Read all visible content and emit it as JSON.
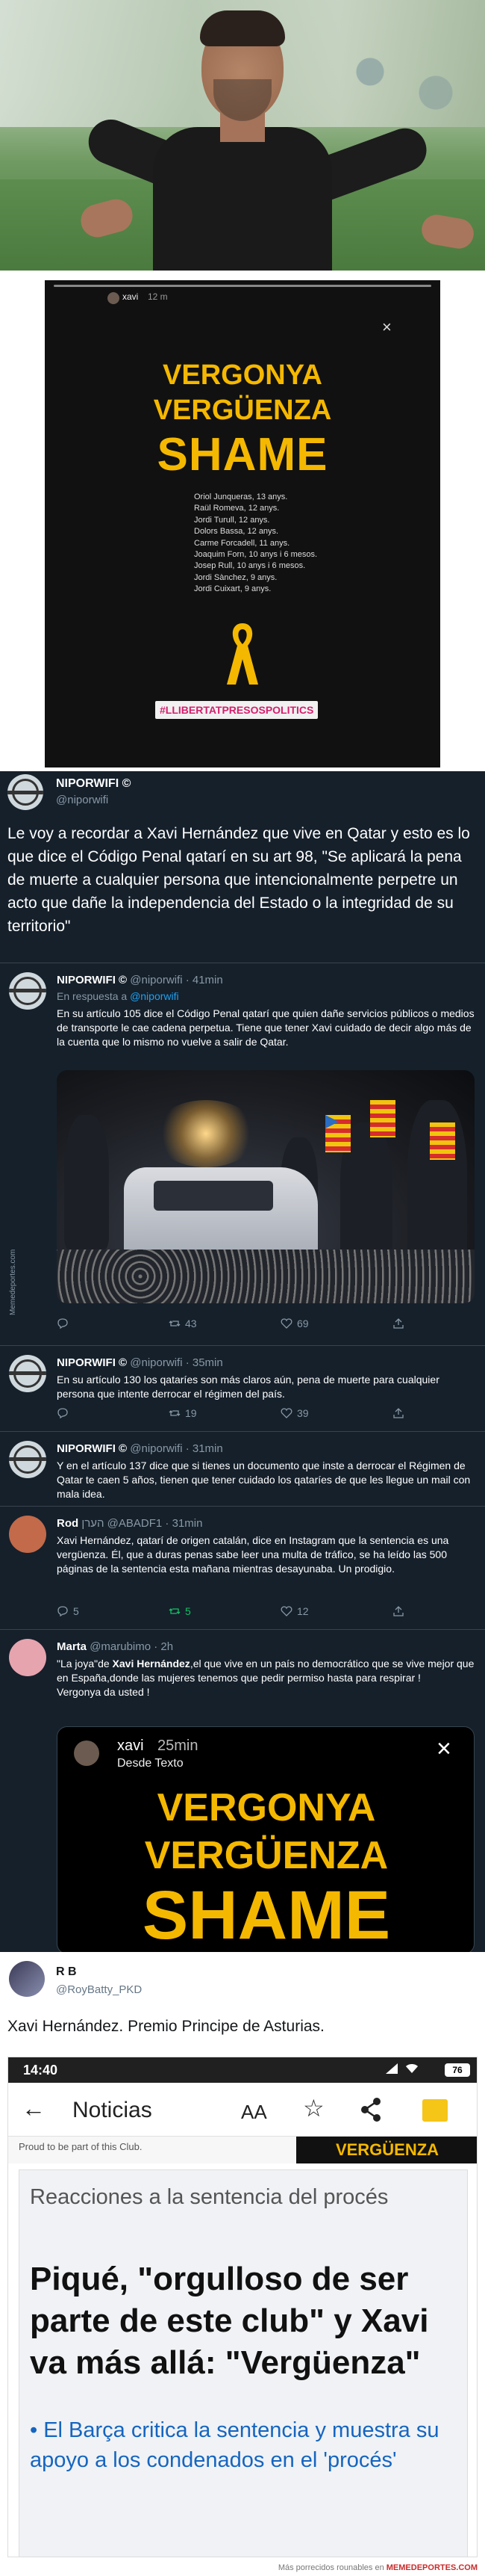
{
  "story": {
    "user": "xavi",
    "time": "12 m",
    "close": "×",
    "word1": "VERGONYA",
    "word2": "VERGÜENZA",
    "word3": "SHAME",
    "names": [
      "Oriol Junqueras, 13 anys.",
      "Raül Romeva, 12 anys.",
      "Jordi Turull, 12 anys.",
      "Dolors Bassa, 12 anys.",
      "Carme Forcadell, 11 anys.",
      "Joaquim Forn, 10 anys i 6 mesos.",
      "Josep Rull, 10 anys i 6 mesos.",
      "Jordi Sànchez, 9 anys.",
      "Jordi Cuixart, 9 anys."
    ],
    "hashtag": "#LLIBERTATPRESOSPOLITICS"
  },
  "main_tweet": {
    "name": "NIPORWIFI ©",
    "handle": "@niporwifi",
    "text": "Le voy a recordar a Xavi Hernández que vive en Qatar y esto es lo que dice el Código Penal qatarí en su art 98, \"Se aplicará la pena de muerte a cualquier persona que intencionalmente perpetre un acto que dañe la independencia del Estado o la integridad de su territorio\""
  },
  "replies": [
    {
      "name": "NIPORWIFI ©",
      "meta": "@niporwifi · 41min",
      "reply_to_label": "En respuesta a",
      "reply_to": "@niporwifi",
      "text": "En su artículo 105 dice el Código Penal qatarí que quien dañe servicios públicos o medios de transporte le cae cadena perpetua. Tiene que tener Xavi cuidado de decir algo más de la cuenta que lo mismo no vuelve a salir de Qatar.",
      "retweets": "43",
      "likes": "69"
    },
    {
      "name": "NIPORWIFI ©",
      "meta": "@niporwifi · 35min",
      "text": "En su artículo 130 los qataríes son más claros aún, pena de muerte para cualquier persona que intente derrocar el régimen del país.",
      "retweets": "19",
      "likes": "39"
    },
    {
      "name": "NIPORWIFI ©",
      "meta": "@niporwifi · 31min",
      "text": "Y en el artículo 137 dice que si tienes un documento que inste a derrocar el Régimen de Qatar te caen 5 años, tienen que tener cuidado los qataríes de que les llegue un mail con mala idea."
    },
    {
      "name": "Rod",
      "meta": "הערן @ABADF1 · 31min",
      "text": "Xavi Hernández, qatarí de origen catalán, dice en Instagram que la sentencia es una vergüenza. Él, que a duras penas sabe leer una multa de tráfico, se ha leído las 500 páginas de la sentencia esta mañana mientras desayunaba. Un prodigio.",
      "bold_lead": "Xavi Hernández",
      "replies": "5",
      "retweets": "5",
      "likes": "12"
    },
    {
      "name": "Marta",
      "meta": "@marubimo · 2h",
      "text_pre": "\"La joya\"de ",
      "text_bold": "Xavi Hernández",
      "text_post": ",el que vive en un país no democrático que se vive mejor que en España,donde las  mujeres tenemos que pedir permiso hasta para respirar !",
      "text_line2": "Vergonya da usted !",
      "embed_user": "xavi",
      "embed_time": "25min",
      "embed_sub": "Desde Texto"
    }
  ],
  "vertical_label": "Memedeportes.com",
  "rb_tweet": {
    "name": "R B",
    "handle": "@RoyBatty_PKD",
    "text": "Xavi Hernández. Premio Principe de Asturias."
  },
  "phone": {
    "time": "14:40",
    "battery": "76",
    "title": "Noticias",
    "aa": "AA",
    "strip_text": "Proud to be part of this Club.",
    "strip_word": "VERGÜENZA",
    "kicker": "Reacciones a la sentencia del procés",
    "headline": "Piqué, \"orgulloso de ser parte de este club\" y Xavi va más allá: \"Vergüenza\"",
    "bullet": "• El Barça critica la sentencia y muestra su apoyo a los condenados en el 'procés'"
  },
  "footer": {
    "pre": "Más porrecidos rounables en",
    "brand": "MEMEDEPORTES.COM"
  },
  "colors": {
    "story_yellow": "#f5b800",
    "twitter_dark": "#15202b",
    "twitter_blue": "#1da1f2",
    "retweet_green": "#17bf63"
  }
}
